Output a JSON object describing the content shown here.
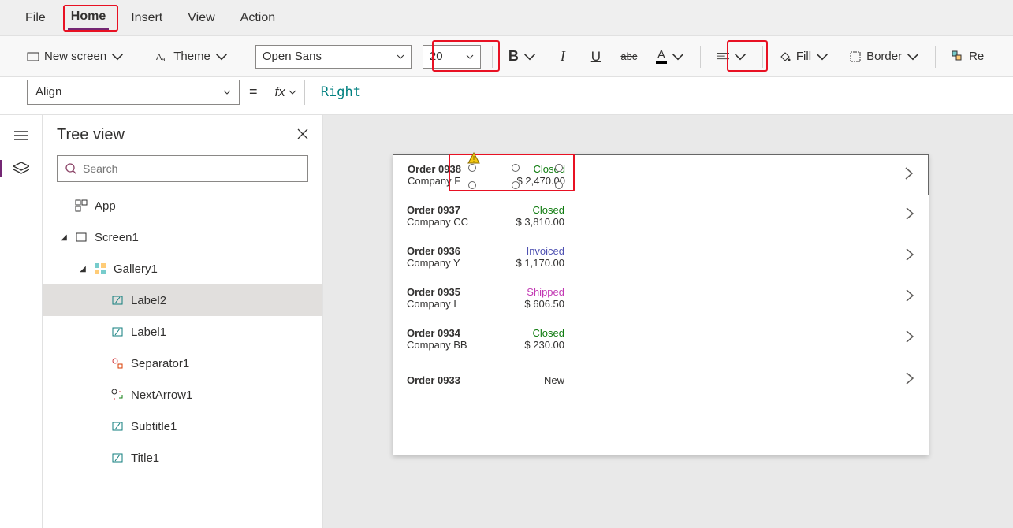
{
  "menu": {
    "file": "File",
    "home": "Home",
    "insert": "Insert",
    "view": "View",
    "action": "Action"
  },
  "ribbon": {
    "new_screen": "New screen",
    "theme": "Theme",
    "font": "Open Sans",
    "size": "20",
    "fill": "Fill",
    "border": "Border",
    "reorder": "Re"
  },
  "formula": {
    "prop": "Align",
    "value": "Right"
  },
  "panel": {
    "title": "Tree view",
    "search_ph": "Search"
  },
  "tree": {
    "app": "App",
    "screen1": "Screen1",
    "gallery1": "Gallery1",
    "label2": "Label2",
    "label1": "Label1",
    "separator1": "Separator1",
    "nextarrow1": "NextArrow1",
    "subtitle1": "Subtitle1",
    "title1": "Title1"
  },
  "gallery": [
    {
      "order": "Order 0938",
      "company": "Company F",
      "status": "Closed",
      "status_cls": "st-closed",
      "price": "$ 2,470.00"
    },
    {
      "order": "Order 0937",
      "company": "Company CC",
      "status": "Closed",
      "status_cls": "st-closed",
      "price": "$ 3,810.00"
    },
    {
      "order": "Order 0936",
      "company": "Company Y",
      "status": "Invoiced",
      "status_cls": "st-invoiced",
      "price": "$ 1,170.00"
    },
    {
      "order": "Order 0935",
      "company": "Company I",
      "status": "Shipped",
      "status_cls": "st-shipped",
      "price": "$ 606.50"
    },
    {
      "order": "Order 0934",
      "company": "Company BB",
      "status": "Closed",
      "status_cls": "st-closed",
      "price": "$ 230.00"
    },
    {
      "order": "Order 0933",
      "company": "",
      "status": "New",
      "status_cls": "st-new",
      "price": ""
    }
  ]
}
